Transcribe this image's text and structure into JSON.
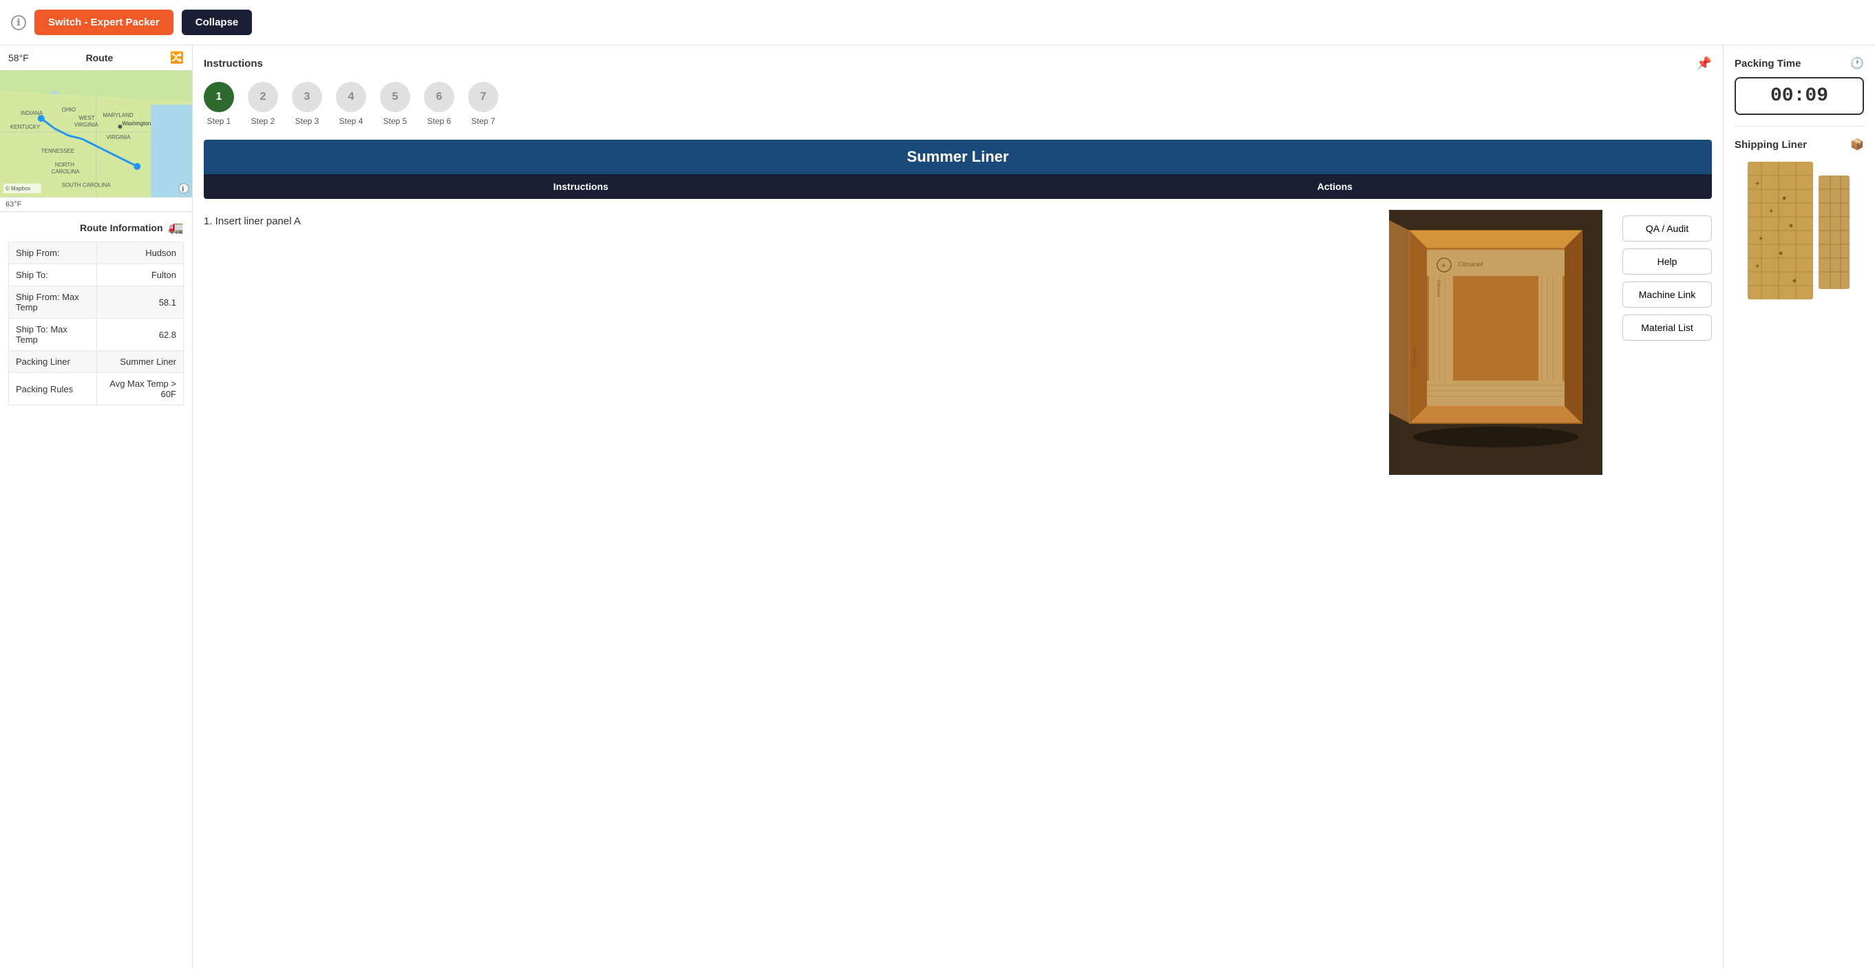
{
  "topbar": {
    "info_icon": "ℹ",
    "switch_button_label": "Switch - Expert Packer",
    "collapse_button_label": "Collapse"
  },
  "left_panel": {
    "map": {
      "title": "Route",
      "temp_top": "58°F",
      "temp_bottom": "63°F"
    },
    "route_info": {
      "title": "Route Information",
      "rows": [
        {
          "label": "Ship From:",
          "value": "Hudson"
        },
        {
          "label": "Ship To:",
          "value": "Fulton"
        },
        {
          "label": "Ship From: Max Temp",
          "value": "58.1"
        },
        {
          "label": "Ship To: Max Temp",
          "value": "62.8"
        },
        {
          "label": "Packing Liner",
          "value": "Summer Liner"
        },
        {
          "label": "Packing Rules",
          "value": "Avg Max Temp > 60F"
        }
      ]
    }
  },
  "middle_panel": {
    "instructions_title": "Instructions",
    "steps": [
      {
        "number": "1",
        "label": "Step 1",
        "active": true
      },
      {
        "number": "2",
        "label": "Step 2",
        "active": false
      },
      {
        "number": "3",
        "label": "Step 3",
        "active": false
      },
      {
        "number": "4",
        "label": "Step 4",
        "active": false
      },
      {
        "number": "5",
        "label": "Step 5",
        "active": false
      },
      {
        "number": "6",
        "label": "Step 6",
        "active": false
      },
      {
        "number": "7",
        "label": "Step 7",
        "active": false
      }
    ],
    "liner_title": "Summer Liner",
    "bar_instructions": "Instructions",
    "bar_actions": "Actions",
    "instruction_text": "1. Insert liner panel A",
    "actions": [
      {
        "label": "QA / Audit"
      },
      {
        "label": "Help"
      },
      {
        "label": "Machine Link"
      },
      {
        "label": "Material List"
      }
    ]
  },
  "right_panel": {
    "packing_time_title": "Packing Time",
    "timer_value": "00:09",
    "shipping_liner_title": "Shipping Liner"
  }
}
